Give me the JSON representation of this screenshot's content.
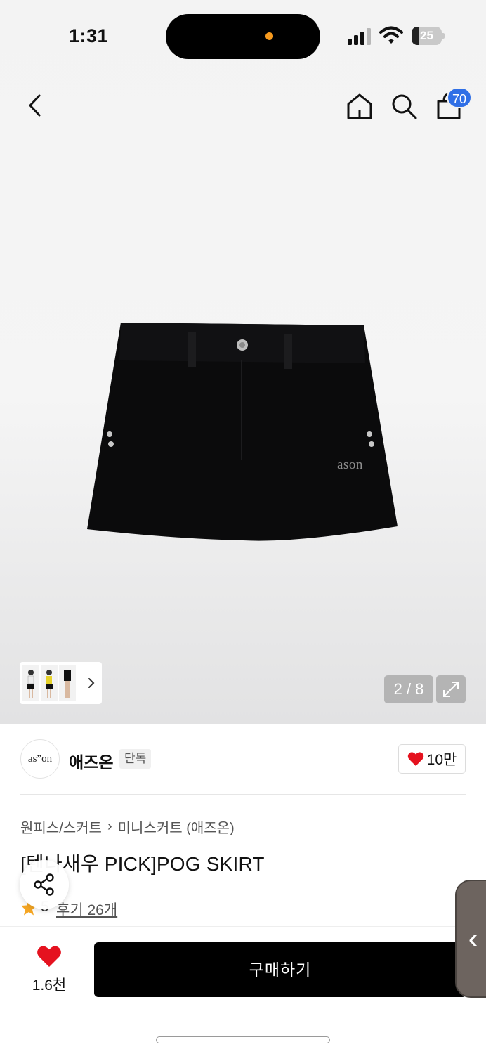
{
  "status_bar": {
    "time": "1:31",
    "battery": "25"
  },
  "header": {
    "cart_count": "70"
  },
  "product_image": {
    "logo_text": "ason"
  },
  "gallery": {
    "pager": "2 / 8"
  },
  "brand": {
    "logo_text": "as”on",
    "name": "애즈온",
    "badge": "단독",
    "likes": "10만"
  },
  "product": {
    "breadcrumb": [
      "원피스/스커트",
      "미니스커트 (애즈온)"
    ],
    "title": "[텐나새우 PICK]POG SKIRT",
    "rating": "5",
    "reviews": "후기 26개"
  },
  "bottom": {
    "wish_count": "1.6천",
    "buy_label": "구매하기"
  },
  "colors": {
    "accent": "#2f6fe6",
    "heart": "#e5121f",
    "buy": "#000000"
  },
  "icons": [
    "back-icon",
    "home-icon",
    "search-icon",
    "bag-icon",
    "chevron-right-icon",
    "expand-icon",
    "heart-icon",
    "star-icon",
    "share-icon"
  ]
}
